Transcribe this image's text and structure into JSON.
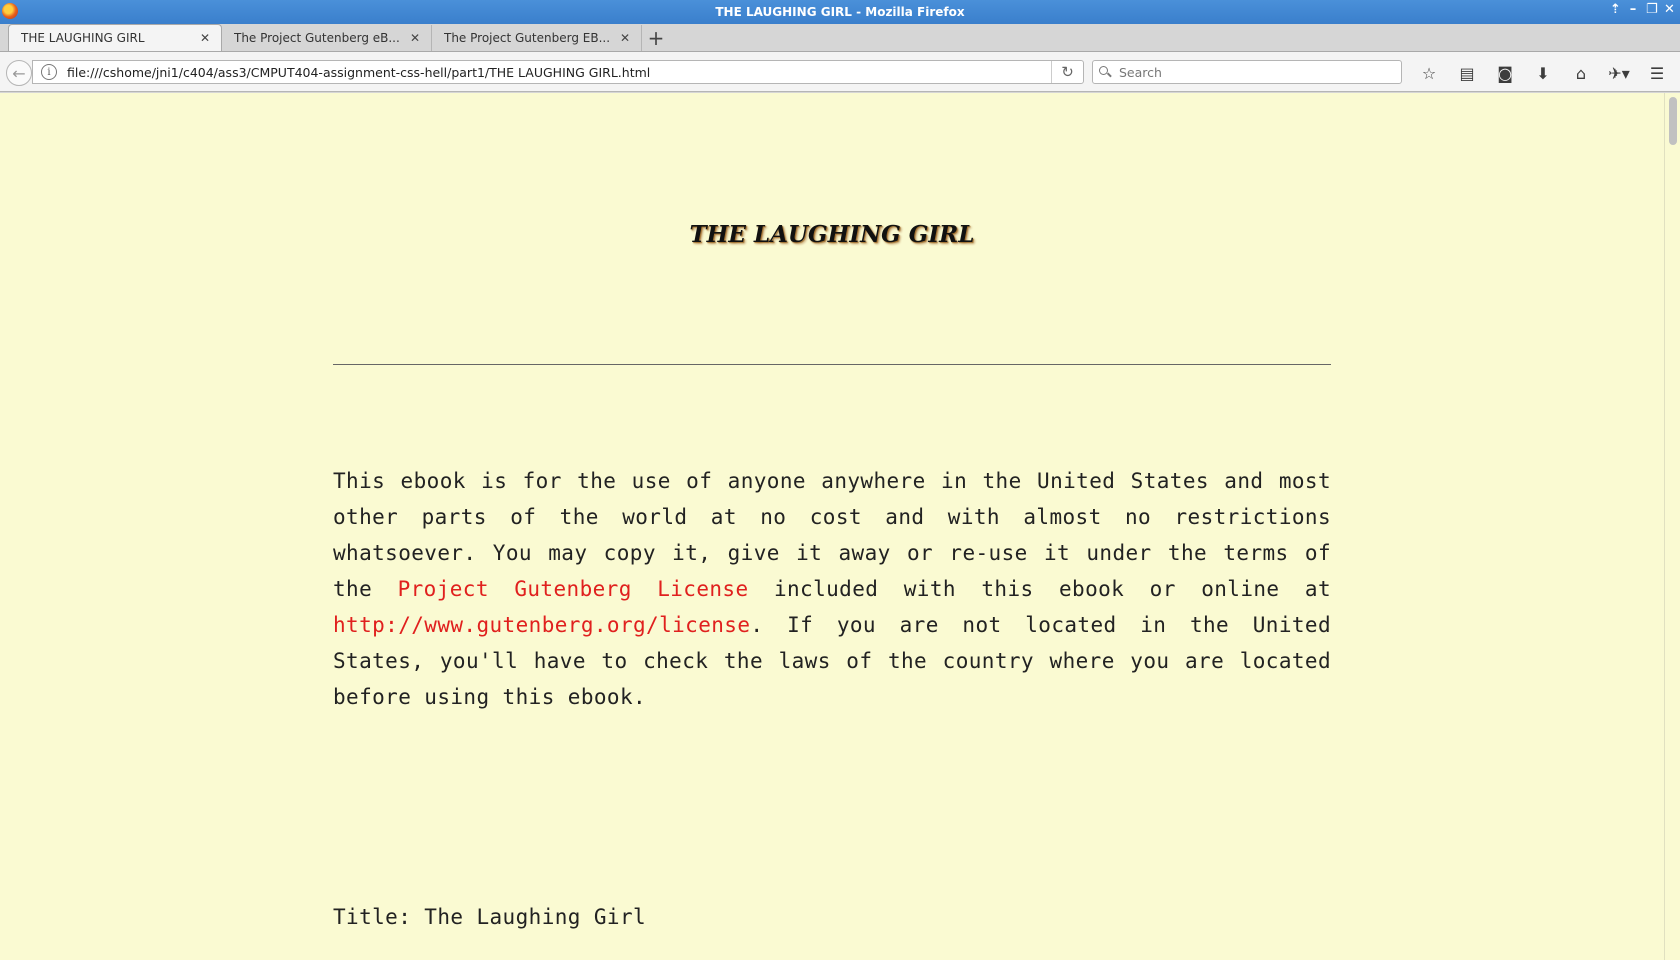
{
  "window": {
    "title": "THE LAUGHING GIRL - Mozilla Firefox"
  },
  "tabs": [
    {
      "label": "THE LAUGHING GIRL",
      "active": true
    },
    {
      "label": "The Project Gutenberg eB...",
      "active": false
    },
    {
      "label": "The Project Gutenberg EB...",
      "active": false
    }
  ],
  "navbar": {
    "url": "file:///cshome/jni1/c404/ass3/CMPUT404-assignment-css-hell/part1/THE LAUGHING GIRL.html",
    "search_placeholder": "Search"
  },
  "content": {
    "heading": "THE LAUGHING GIRL",
    "paragraph": {
      "part1": "This ebook is for the use of anyone anywhere in the United States and most other parts of the world at no cost and with almost no restrictions whatsoever. You may copy it, give it away or re-use it under the terms of the ",
      "link1": "Project Gutenberg License",
      "part2": " included with this ebook or online at ",
      "link2": "http://www.gutenberg.org/license",
      "part3": ". If you are not located in the United States, you'll have to check the laws of the country where you are located before using this ebook."
    },
    "title_line": "Title: The Laughing Girl"
  },
  "colors": {
    "page_background": "#fafad2",
    "link": "#e0201e",
    "titlebar": "#3a7fcc"
  },
  "icons": {
    "window_controls": [
      "arrow-up-icon",
      "minimize-icon",
      "restore-icon",
      "close-icon"
    ],
    "toolbar": [
      "bookmark-star-icon",
      "reader-list-icon",
      "pocket-icon",
      "download-icon",
      "home-icon",
      "extension-icon",
      "menu-hamburger-icon"
    ]
  }
}
